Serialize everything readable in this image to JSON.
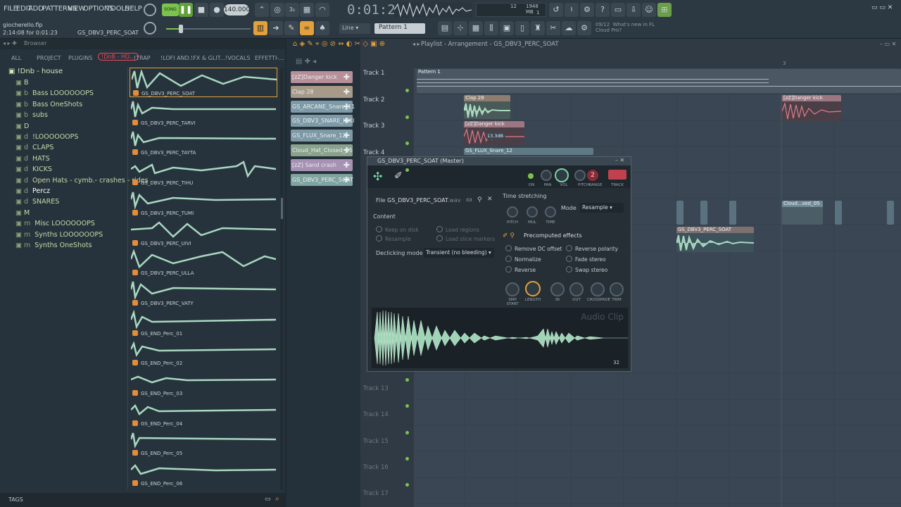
{
  "menu": {
    "items": [
      "FILE",
      "EDIT",
      "ADD",
      "PATTERNS",
      "VIEW",
      "OPTIONS",
      "TOOLS",
      "HELP"
    ]
  },
  "transport": {
    "song_label": "SONG",
    "tempo": "140.000",
    "time": "0:01:29",
    "cpu_label": "12",
    "mem": "1948 MB",
    "mem_sub": "1"
  },
  "project": {
    "file": "giocherello.flp",
    "time_info": "2:14:08 for 0:01:23",
    "hint": "GS_DBV3_PERC_SOAT"
  },
  "toolbar": {
    "snap": "Line",
    "pattern": "Pattern 1"
  },
  "news": {
    "date": "09/12",
    "line1": "What's new in FL",
    "line2": "Cloud Pro?"
  },
  "browser": {
    "title": "Browser",
    "tabs": [
      "ALL",
      "PROJECT",
      "PLUGINS",
      "!DnB - HO...",
      "!TRAP",
      "!LOFI AND...",
      "!FX & GLIT...",
      "!VOCALS",
      "EFFETTI-..."
    ],
    "active_tab": 3,
    "root": "!Dnb - house",
    "tree": [
      {
        "prefix": "",
        "label": "B"
      },
      {
        "prefix": "b",
        "label": "Bass LOOOOOOPS"
      },
      {
        "prefix": "b",
        "label": "Bass OneShots"
      },
      {
        "prefix": "b",
        "label": "subs"
      },
      {
        "prefix": "",
        "label": "D"
      },
      {
        "prefix": "d",
        "label": "!LOOOOOOPS"
      },
      {
        "prefix": "d",
        "label": "CLAPS"
      },
      {
        "prefix": "d",
        "label": "HATS"
      },
      {
        "prefix": "d",
        "label": "KICKS"
      },
      {
        "prefix": "d",
        "label": "Open Hats - cymb.- crashes - rides"
      },
      {
        "prefix": "d",
        "label": "Percz"
      },
      {
        "prefix": "d",
        "label": "SNARES"
      },
      {
        "prefix": "",
        "label": "M"
      },
      {
        "prefix": "m",
        "label": "Misc LOOOOOOPS"
      },
      {
        "prefix": "m",
        "label": "Synths LOOOOOOPS"
      },
      {
        "prefix": "m",
        "label": "Synths OneShots"
      }
    ],
    "selected_tree": 10,
    "samples": [
      "GS_DBV3_PERC_SOAT",
      "GS_DBV3_PERC_TARVI",
      "GS_DBV3_PERC_TAYTA",
      "GS_DBV3_PERC_TIHU",
      "GS_DBV3_PERC_TUMI",
      "GS_DBV3_PERC_UIVI",
      "GS_DBV3_PERC_ULLA",
      "GS_DBV3_PERC_VATY",
      "GS_END_Perc_01",
      "GS_END_Perc_02",
      "GS_END_Perc_03",
      "GS_END_Perc_04",
      "GS_END_Perc_05",
      "GS_END_Perc_06"
    ],
    "tags_label": "TAGS"
  },
  "channels": [
    {
      "name": "[zZ]Danger kick",
      "color": "#b78f98"
    },
    {
      "name": "Clap 28",
      "color": "#a79a88"
    },
    {
      "name": "GS_ARCANE_Snare_11",
      "color": "#7e9aa6"
    },
    {
      "name": "GS_DBV3_SNARE_INKI",
      "color": "#7e9aa6"
    },
    {
      "name": "GS_FLUX_Snare_12",
      "color": "#7e9aa6"
    },
    {
      "name": "Cloud_Hat_Closed_05",
      "color": "#8aa28c"
    },
    {
      "name": "[zZ] Sand crash",
      "color": "#a792b3"
    },
    {
      "name": "GS_DBV3_PERC_SOAT",
      "color": "#7fa4a0"
    }
  ],
  "playlist": {
    "title": "Playlist - Arrangement - GS_DBV3_PERC_SOAT",
    "bar_marker": "3",
    "tracks_top": [
      "Track 1",
      "Track 2",
      "Track 3",
      "Track 4"
    ],
    "tracks_bottom": [
      "Track 13",
      "Track 14",
      "Track 15",
      "Track 16",
      "Track 17"
    ],
    "clips": {
      "pattern": "Pattern 1",
      "clap": "Clap 28",
      "kick": "[zZ]Danger kick",
      "kick_right": "[zZ]Danger kick",
      "kick_badge": "13.3dB",
      "flux": "GS_FLUX_Snare_12",
      "cloud": "Cloud...sed_05",
      "soat": "GS_DBV3_PERC_SOAT"
    }
  },
  "sampler": {
    "title": "GS_DBV3_PERC_SOAT (Master)",
    "knob_labels": [
      "ON",
      "PAN",
      "VOL",
      "PITCH",
      "RANGE",
      "TRACK"
    ],
    "range_value": "2",
    "file_label": "File",
    "file_name": "GS_DBV3_PERC_SOAT",
    "file_ext": ".wav",
    "content_label": "Content",
    "content_opts": [
      "Keep on disk",
      "Load regions",
      "Resample",
      "Load slice markers"
    ],
    "declick_label": "Declicking mode",
    "declick_value": "Transient (no bleeding)",
    "ts_label": "Time stretching",
    "ts_knobs": [
      "PITCH",
      "MUL",
      "TIME"
    ],
    "mode_label": "Mode",
    "mode_value": "Resample",
    "precomputed": "Precomputed effects",
    "effects": [
      "Remove DC offset",
      "Reverse polarity",
      "Normalize",
      "Fade stereo",
      "Reverse",
      "Swap stereo"
    ],
    "bottom_knobs": [
      "SMP START",
      "LENGTH",
      "IN",
      "OUT",
      "CROSSFADE",
      "TRIM"
    ],
    "watermark": "Audio Clip",
    "zoom": "32"
  },
  "colors": {
    "accent": "#e2a13c",
    "waveform": "#a9d8c0",
    "active_tab": "#e24a5a"
  }
}
